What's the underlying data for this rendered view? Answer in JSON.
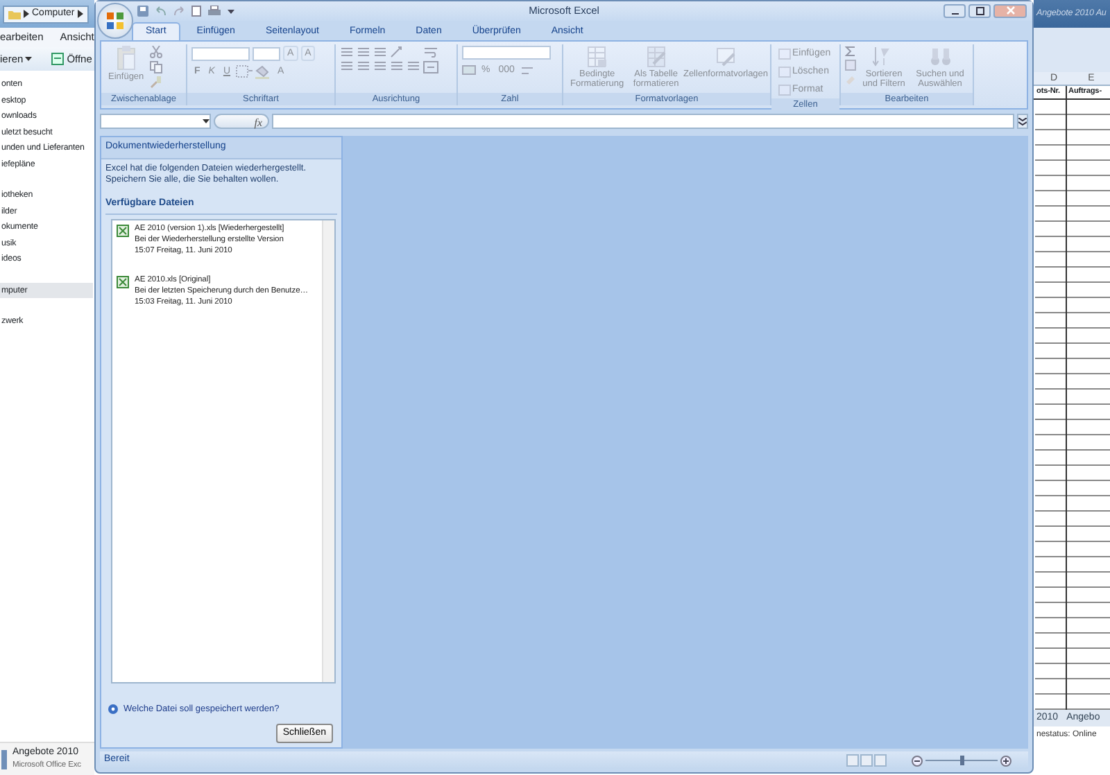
{
  "explorer": {
    "breadcrumb": "Computer",
    "menu": [
      "earbeiten",
      "Ansicht"
    ],
    "toolbar": [
      "ieren",
      "Öffne"
    ],
    "nav_groups": [
      [
        {
          "label": "onten",
          "selected": false
        },
        {
          "label": "esktop",
          "selected": false
        },
        {
          "label": "ownloads",
          "selected": false
        },
        {
          "label": "uletzt besucht",
          "selected": false
        },
        {
          "label": "unden und Lieferanten",
          "selected": false
        },
        {
          "label": "iefepläne",
          "selected": false
        }
      ],
      [
        {
          "label": "iotheken",
          "selected": false
        },
        {
          "label": "ilder",
          "selected": false
        },
        {
          "label": "okumente",
          "selected": false
        },
        {
          "label": "usik",
          "selected": false
        },
        {
          "label": "ideos",
          "selected": false
        }
      ],
      [
        {
          "label": "mputer",
          "selected": true
        }
      ],
      [
        {
          "label": "zwerk",
          "selected": false
        }
      ]
    ],
    "taskbar_item": {
      "title": "Angebote 2010",
      "subtitle": "Microsoft Office Exc"
    }
  },
  "background_sheet": {
    "title": "Angebote 2010 Au",
    "columns": [
      "D",
      "E"
    ],
    "headers": [
      "ots-Nr.",
      "Auftrags-"
    ],
    "sheet_tabs": [
      "2010",
      "Angebo"
    ],
    "status": "nestatus: Online"
  },
  "window": {
    "title": "Microsoft Excel"
  },
  "ribbon": {
    "disabled": true,
    "tabs": [
      {
        "label": "Start",
        "selected": true
      },
      {
        "label": "Einfügen",
        "selected": false
      },
      {
        "label": "Seitenlayout",
        "selected": false
      },
      {
        "label": "Formeln",
        "selected": false
      },
      {
        "label": "Daten",
        "selected": false
      },
      {
        "label": "Überprüfen",
        "selected": false
      },
      {
        "label": "Ansicht",
        "selected": false
      }
    ],
    "groups": [
      {
        "kind": "clipboard",
        "label": "Zwischenablage",
        "commands": [
          "Einfügen"
        ]
      },
      {
        "kind": "font",
        "label": "Schriftart",
        "commands": [
          "A",
          "A",
          "F",
          "K",
          "U",
          "A"
        ]
      },
      {
        "kind": "alignment",
        "label": "Ausrichtung"
      },
      {
        "kind": "number",
        "label": "Zahl",
        "commands": [
          "%",
          "000"
        ]
      },
      {
        "kind": "styles",
        "label": "Formatvorlagen",
        "commands": [
          "Bedingte Formatierung",
          "Als Tabelle formatieren",
          "Zellenformatvorlagen"
        ]
      },
      {
        "kind": "cells",
        "label": "Zellen",
        "commands": [
          "Einfügen",
          "Löschen",
          "Format"
        ]
      },
      {
        "kind": "editing",
        "label": "Bearbeiten",
        "commands": [
          "Sortieren und Filtern",
          "Suchen und Auswählen"
        ]
      }
    ]
  },
  "formula_bar": {
    "function_label": "fx"
  },
  "recovery_pane": {
    "title": "Dokumentwiederherstellung",
    "intro": "Excel hat die folgenden Dateien wiederhergestellt. Speichern Sie alle, die Sie behalten wollen.",
    "section": "Verfügbare Dateien",
    "files": [
      {
        "name": "AE 2010 (version 1).xls  [Wiederhergestellt]",
        "description": "Bei der Wiederherstellung erstellte Version",
        "time": "15:07 Freitag, 11. Juni 2010"
      },
      {
        "name": "AE 2010.xls  [Original]",
        "description": "Bei der letzten Speicherung durch den Benutze…",
        "time": "15:03 Freitag, 11. Juni 2010"
      }
    ],
    "help_link": "Welche Datei soll gespeichert werden?",
    "close_button": "Schließen"
  },
  "status_bar": {
    "text": "Bereit",
    "zoom": {
      "level": 0.5
    }
  }
}
